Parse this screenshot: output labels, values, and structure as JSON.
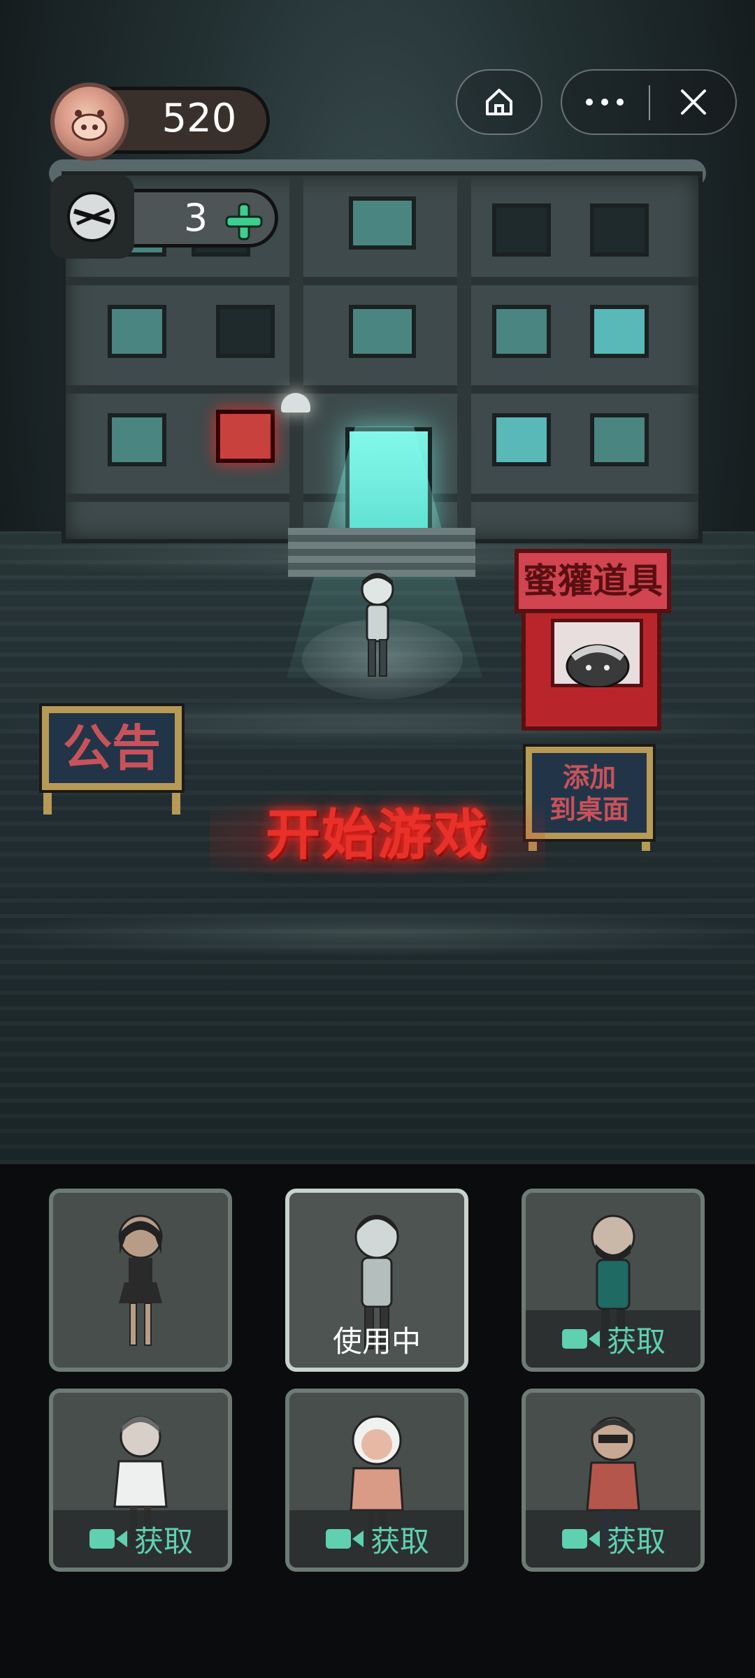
{
  "hud": {
    "coins": "520",
    "puzzle_count": "3",
    "coin_icon": "pig-coin-icon",
    "puzzle_icon": "puzzle-piece-icon",
    "plus_icon": "plus-icon"
  },
  "capsule": {
    "home_icon": "home-icon",
    "more_icon": "more-icon",
    "close_icon": "close-icon"
  },
  "scene": {
    "notice_label": "公告",
    "shop_label": "蜜獾道具",
    "desktop_line1": "添加",
    "desktop_line2": "到桌面",
    "start_label": "开始游戏"
  },
  "characters": [
    {
      "state": "owned",
      "label": ""
    },
    {
      "state": "active",
      "label": "使用中"
    },
    {
      "state": "locked",
      "label": "获取"
    },
    {
      "state": "locked",
      "label": "获取"
    },
    {
      "state": "locked",
      "label": "获取"
    },
    {
      "state": "locked",
      "label": "获取"
    }
  ],
  "colors": {
    "accent_red": "#e8312a",
    "get_green": "#5fd0b0",
    "plus_green": "#3ecf8e"
  }
}
